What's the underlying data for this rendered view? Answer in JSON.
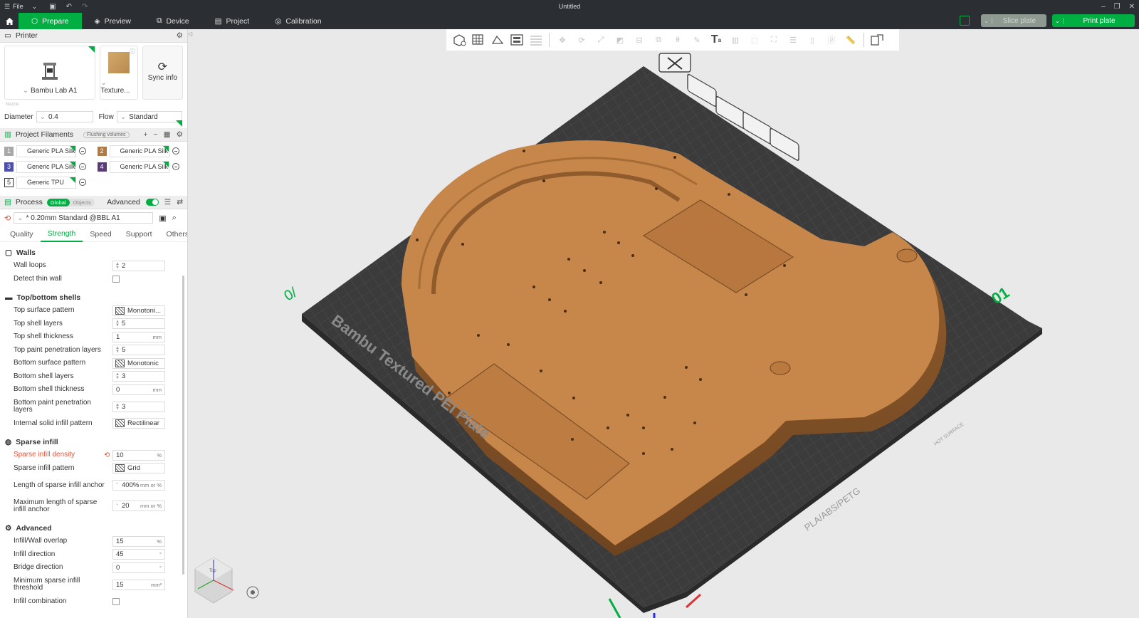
{
  "titlebar": {
    "file_label": "File",
    "title": "Untitled"
  },
  "nav": {
    "tabs": [
      {
        "label": "Prepare",
        "active": true
      },
      {
        "label": "Preview"
      },
      {
        "label": "Device"
      },
      {
        "label": "Project"
      },
      {
        "label": "Calibration"
      }
    ],
    "slice_label": "Slice plate",
    "print_label": "Print plate"
  },
  "printer": {
    "header": "Printer",
    "name": "Bambu Lab A1",
    "plate": "Texture...",
    "sync_label": "Sync info",
    "nozzle_label": "Nozzle",
    "diameter_label": "Diameter",
    "diameter_value": "0.4",
    "flow_label": "Flow",
    "flow_value": "Standard"
  },
  "filaments": {
    "header": "Project Filaments",
    "flushing_label": "Flushing volumes",
    "items": [
      {
        "num": "1",
        "name": "Generic PLA Silk",
        "color": "#a8a8a8"
      },
      {
        "num": "2",
        "name": "Generic PLA Silk",
        "color": "#b07a42"
      },
      {
        "num": "3",
        "name": "Generic PLA Silk",
        "color": "#4b4fa8"
      },
      {
        "num": "4",
        "name": "Generic PLA Silk",
        "color": "#5a3b78"
      },
      {
        "num": "5",
        "name": "Generic TPU",
        "color": "#ffffff"
      }
    ]
  },
  "process": {
    "header": "Process",
    "toggle_global": "Global",
    "toggle_objects": "Objects",
    "advanced_label": "Advanced",
    "preset": "* 0.20mm Standard @BBL A1",
    "tabs": [
      "Quality",
      "Strength",
      "Speed",
      "Support",
      "Others"
    ],
    "active_tab": "Strength",
    "groups": {
      "walls": "Walls",
      "shells": "Top/bottom shells",
      "infill": "Sparse infill",
      "advanced": "Advanced"
    },
    "walls": [
      {
        "label": "Wall loops",
        "value": "2"
      },
      {
        "label": "Detect thin wall",
        "checked": false
      }
    ],
    "shells": [
      {
        "label": "Top surface pattern",
        "value": "Monotoni..."
      },
      {
        "label": "Top shell layers",
        "value": "5"
      },
      {
        "label": "Top shell thickness",
        "value": "1",
        "unit": "mm"
      },
      {
        "label": "Top paint penetration layers",
        "value": "5"
      },
      {
        "label": "Bottom surface pattern",
        "value": "Monotonic"
      },
      {
        "label": "Bottom shell layers",
        "value": "3"
      },
      {
        "label": "Bottom shell thickness",
        "value": "0",
        "unit": "mm"
      },
      {
        "label": "Bottom paint penetration layers",
        "value": "3"
      },
      {
        "label": "Internal solid infill pattern",
        "value": "Rectilinear"
      }
    ],
    "infill": [
      {
        "label": "Sparse infill density",
        "value": "10",
        "unit": "%"
      },
      {
        "label": "Sparse infill pattern",
        "value": "Grid"
      },
      {
        "label": "Length of sparse infill anchor",
        "value": "400%",
        "unit": "mm or %"
      },
      {
        "label": "Maximum length of sparse infill anchor",
        "value": "20",
        "unit": "mm or %"
      }
    ],
    "advanced": [
      {
        "label": "Infill/Wall overlap",
        "value": "15",
        "unit": "%"
      },
      {
        "label": "Infill direction",
        "value": "45",
        "unit": "°"
      },
      {
        "label": "Bridge direction",
        "value": "0",
        "unit": "°"
      },
      {
        "label": "Minimum sparse infill threshold",
        "value": "15",
        "unit": "mm²"
      },
      {
        "label": "Infill combination",
        "checked": false
      }
    ]
  },
  "viewport": {
    "plate_text": "Bambu Textured PEI Plate",
    "plate_number": "01",
    "plate_material": "PLA/ABS/PETG",
    "hot_surface": "HOT SURFACE",
    "cube_label": "Top",
    "model_color": "#c8874a",
    "accent": "#00ae42"
  }
}
